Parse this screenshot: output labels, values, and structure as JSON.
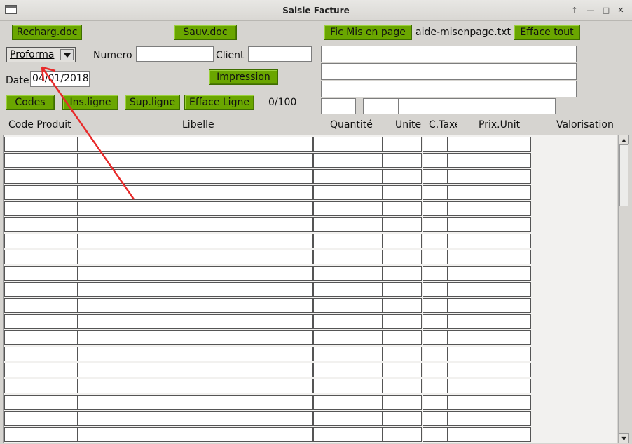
{
  "window": {
    "title": "Saisie Facture"
  },
  "buttons": {
    "recharg": "Recharg.doc",
    "sauv": "Sauv.doc",
    "fic": "Fic Mis en page",
    "efface_tout": "Efface tout",
    "impression": "Impression",
    "codes": "Codes",
    "ins": "Ins.ligne",
    "sup": "Sup.ligne",
    "efface_ligne": "Efface Ligne"
  },
  "doc_type": {
    "selected": "Proforma"
  },
  "labels": {
    "numero": "Numero",
    "client": "Client",
    "date": "Date"
  },
  "fields": {
    "date": "04/01/2018",
    "numero": "",
    "client": ""
  },
  "misenpage_file": "aide-misenpage.txt",
  "line_counter": "0/100",
  "columns": [
    "Code Produit",
    "Libelle",
    "Quantité",
    "Unite",
    "C.Taxe",
    "Prix.Unit",
    "Valorisation"
  ],
  "colors": {
    "button_green": "#6aa600",
    "arrow_red": "#e82a2a"
  }
}
